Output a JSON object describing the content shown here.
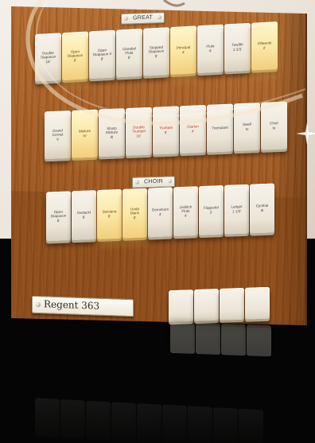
{
  "division_labels": {
    "great": "GREAT",
    "choir": "CHOIR"
  },
  "great_row": [
    {
      "label": "Double\nDiapason\n16'",
      "lit": false,
      "red": false
    },
    {
      "label": "Open\nDiapason\n8'",
      "lit": true,
      "red": false
    },
    {
      "label": "Open\nDiapason II\n8'",
      "lit": false,
      "red": false
    },
    {
      "label": "Clarabel\nFlute\n8'",
      "lit": false,
      "red": false
    },
    {
      "label": "Stopped\nDiapason\n8'",
      "lit": false,
      "red": false
    },
    {
      "label": "Principal\n4'",
      "lit": true,
      "red": false
    },
    {
      "label": "Flute\n4'",
      "lit": false,
      "red": false
    },
    {
      "label": "Twelfth\n2 2/3'",
      "lit": false,
      "red": false
    },
    {
      "label": "Fifteenth\n2'",
      "lit": true,
      "red": false
    }
  ],
  "great_row2": [
    {
      "label": "Grand\nCornet\nV",
      "lit": false,
      "red": false
    },
    {
      "label": "Mixture\nIV",
      "lit": true,
      "red": false
    },
    {
      "label": "Sharp\nMixture\nIII",
      "lit": false,
      "red": false
    },
    {
      "label": "Double\nTrumpet\n16'",
      "lit": false,
      "red": true
    },
    {
      "label": "Trumpet\n8'",
      "lit": false,
      "red": true
    },
    {
      "label": "Clarion\n4'",
      "lit": false,
      "red": true
    },
    {
      "label": "Tremulant",
      "lit": false,
      "red": false
    },
    {
      "label": "Swell\nto",
      "lit": false,
      "red": false
    },
    {
      "label": "Choir\nto",
      "lit": false,
      "red": false
    }
  ],
  "choir_row": [
    {
      "label": "Open\nDiapason\n8'",
      "lit": false,
      "red": false
    },
    {
      "label": "Gedackt\n8'",
      "lit": false,
      "red": false
    },
    {
      "label": "Dulciana\n8'",
      "lit": true,
      "red": false
    },
    {
      "label": "Unda\nMaris\n8'",
      "lit": true,
      "red": false
    },
    {
      "label": "Gemshorn\n4'",
      "lit": false,
      "red": false
    },
    {
      "label": "Lieblich\nFlute\n4'",
      "lit": false,
      "red": false
    },
    {
      "label": "Flageolet\n2'",
      "lit": false,
      "red": false
    },
    {
      "label": "Larigot\n1 1/3'",
      "lit": false,
      "red": false
    },
    {
      "label": "Cymbal\nIII",
      "lit": false,
      "red": false
    }
  ],
  "partial_row": [
    "",
    "",
    "",
    ""
  ],
  "nameplate": {
    "model": "Regent 363"
  },
  "colors": {
    "wood": "#a45c22",
    "tab_ivory": "#f3eee3",
    "tab_lit": "#fbe6a4",
    "tab_red_text": "#c3332b",
    "background_top": "#ece5db",
    "background_bottom": "#050505"
  }
}
